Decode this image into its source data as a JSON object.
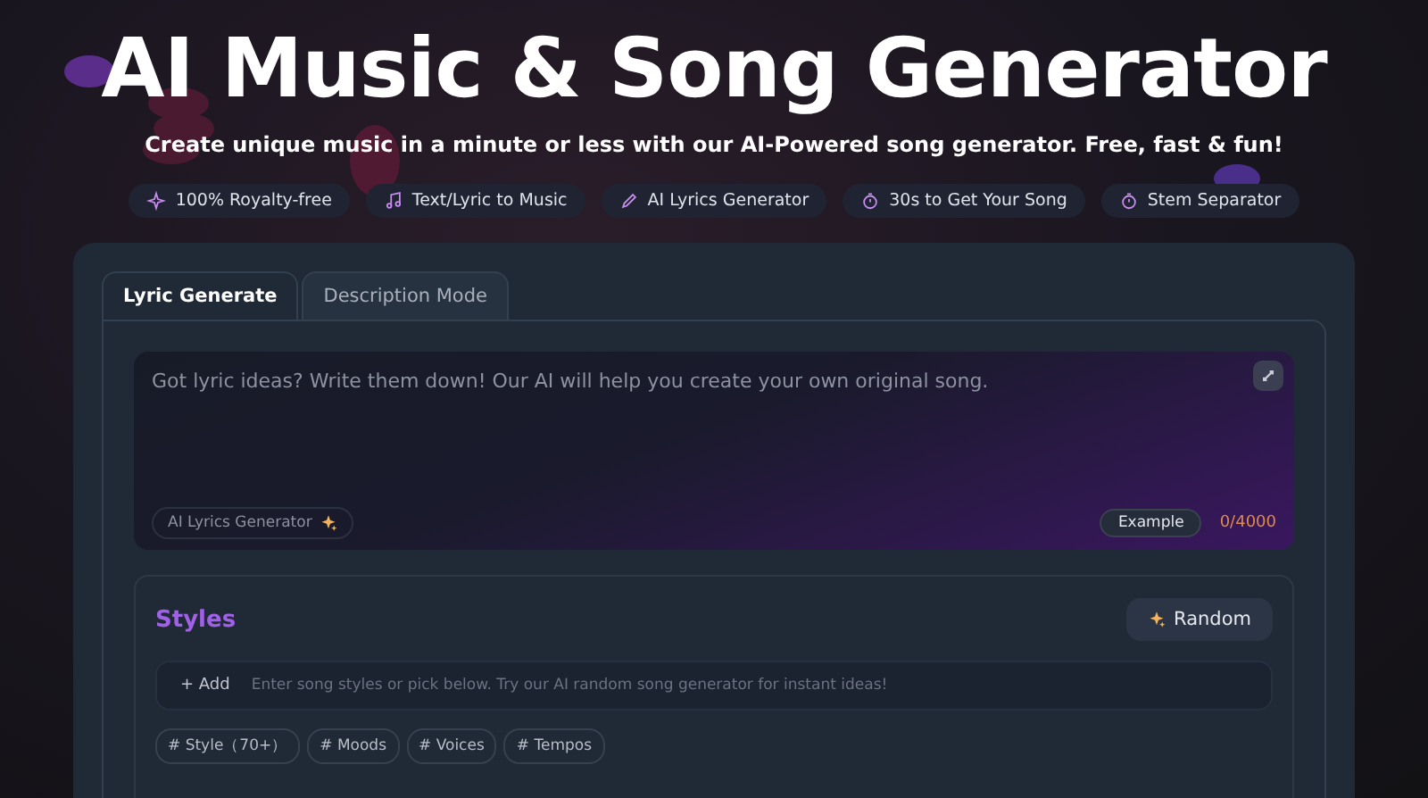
{
  "hero": {
    "title": "AI Music & Song Generator",
    "subtitle": "Create unique music in a minute or less with our AI-Powered song generator. Free, fast & fun!"
  },
  "features": [
    {
      "kind": "sparkle",
      "label": "100% Royalty-free"
    },
    {
      "kind": "note",
      "label": "Text/Lyric to Music"
    },
    {
      "kind": "pen",
      "label": "AI Lyrics Generator"
    },
    {
      "kind": "timer",
      "label": "30s to Get Your Song"
    },
    {
      "kind": "timer",
      "label": "Stem Separator"
    }
  ],
  "tabs": [
    {
      "label": "Lyric Generate",
      "selected": true
    },
    {
      "label": "Description Mode",
      "selected": false
    }
  ],
  "lyrics": {
    "placeholder": "Got lyric ideas? Write them down! Our AI will help you create your own original song.",
    "generator_button": "AI Lyrics Generator",
    "example_button": "Example",
    "counter": "0/4000"
  },
  "styles": {
    "heading": "Styles",
    "random_button": "Random",
    "add_label": "+ Add",
    "placeholder": "Enter song styles or pick below. Try our AI random song generator for instant ideas!",
    "tags": [
      "# Style（70+）",
      "# Moods",
      "# Voices",
      "# Tempos"
    ]
  }
}
